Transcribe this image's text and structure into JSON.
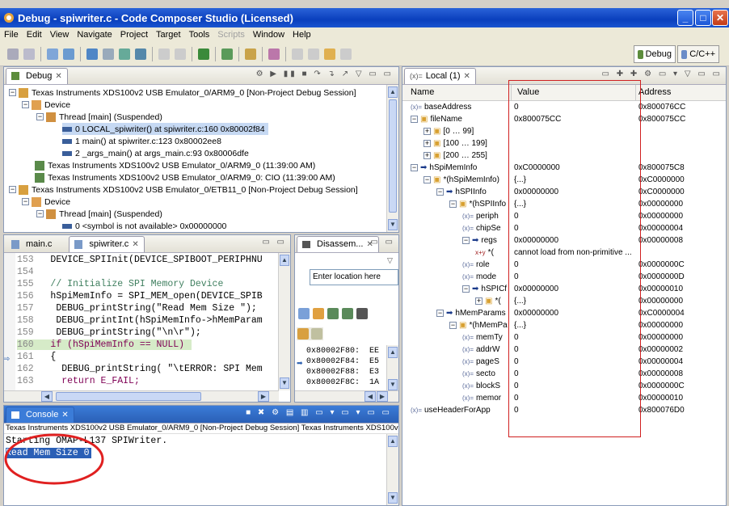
{
  "window": {
    "title": "Debug - spiwriter.c - Code Composer Studio (Licensed)",
    "minimize": "_",
    "maximize": "□",
    "close": "✕"
  },
  "menu": [
    "File",
    "Edit",
    "View",
    "Navigate",
    "Project",
    "Target",
    "Tools",
    "Scripts",
    "Window",
    "Help"
  ],
  "perspectives": {
    "debug": "Debug",
    "cpp": "C/C++"
  },
  "debug_view": {
    "tab": "Debug",
    "items": [
      "Texas Instruments XDS100v2 USB Emulator_0/ARM9_0 [Non-Project Debug Session]",
      "Device",
      "Thread [main] (Suspended)",
      "0 LOCAL_spiwriter() at spiwriter.c:160 0x80002f84",
      "1 main() at spiwriter.c:123 0x80002ee8",
      "2 _args_main() at args_main.c:93 0x80006dfe",
      "Texas Instruments XDS100v2 USB Emulator_0/ARM9_0 (11:39:00 AM)",
      "Texas Instruments XDS100v2 USB Emulator_0/ARM9_0: CIO (11:39:00 AM)",
      "Texas Instruments XDS100v2 USB Emulator_0/ETB11_0 [Non-Project Debug Session]",
      "Device",
      "Thread [main] (Suspended)",
      "0 <symbol is not available> 0x00000000"
    ]
  },
  "editor": {
    "tabs": [
      "main.c",
      "spiwriter.c"
    ],
    "lines": [
      {
        "n": "153",
        "t": "  DEVICE_SPIInit(DEVICE_SPIBOOT_PERIPHNU"
      },
      {
        "n": "154",
        "t": ""
      },
      {
        "n": "155",
        "t": "  // Initialize SPI Memory Device"
      },
      {
        "n": "156",
        "t": "  hSpiMemInfo = SPI_MEM_open(DEVICE_SPIB"
      },
      {
        "n": "157",
        "t": "   DEBUG_printString(\"Read Mem Size \");"
      },
      {
        "n": "158",
        "t": "   DEBUG_printInt(hSpiMemInfo->hMemParam"
      },
      {
        "n": "159",
        "t": "   DEBUG_printString(\"\\n\\r\");"
      },
      {
        "n": "160",
        "t": "  if (hSpiMemInfo == NULL)"
      },
      {
        "n": "161",
        "t": "  {"
      },
      {
        "n": "162",
        "t": "    DEBUG_printString( \"\\tERROR: SPI Mem"
      },
      {
        "n": "163",
        "t": "    return E_FAIL;"
      }
    ]
  },
  "disassembly": {
    "tab": "Disassem...",
    "location_placeholder": "Enter location here",
    "rows": [
      {
        "addr": "0x80002F80:",
        "v": "EE"
      },
      {
        "addr": "0x80002F84:",
        "v": "E5"
      },
      {
        "addr": "0x80002F88:",
        "v": "E3"
      },
      {
        "addr": "0x80002F8C:",
        "v": "1A"
      }
    ]
  },
  "console": {
    "tab": "Console",
    "header": "Texas Instruments XDS100v2 USB Emulator_0/ARM9_0 [Non-Project Debug Session] Texas Instruments XDS100v2",
    "lines": [
      "Starting OMAP-L137 SPIWriter.",
      "Read Mem Size 0"
    ]
  },
  "locals": {
    "tab": "Local (1)",
    "columns": [
      "Name",
      "Value",
      "Address"
    ],
    "rows": [
      {
        "name": "baseAddress",
        "value": "0",
        "addr": "0x800076CC"
      },
      {
        "name": "fileName",
        "value": "0x800075CC",
        "addr": "0x800075CC"
      },
      {
        "name": "[0 … 99]",
        "value": "",
        "addr": ""
      },
      {
        "name": "[100 … 199]",
        "value": "",
        "addr": ""
      },
      {
        "name": "[200 … 255]",
        "value": "",
        "addr": ""
      },
      {
        "name": "hSpiMemInfo",
        "value": "0xC0000000",
        "addr": "0x800075C8"
      },
      {
        "name": "*(hSpiMemInfo)",
        "value": "{...}",
        "addr": "0xC0000000"
      },
      {
        "name": "hSPIInfo",
        "value": "0x00000000",
        "addr": "0xC0000000"
      },
      {
        "name": "*(hSPIInfo",
        "value": "{...}",
        "addr": "0x00000000"
      },
      {
        "name": "periph",
        "value": "0",
        "addr": "0x00000000"
      },
      {
        "name": "chipSe",
        "value": "0",
        "addr": "0x00000004"
      },
      {
        "name": "regs",
        "value": "0x00000000",
        "addr": "0x00000008"
      },
      {
        "name": "*(",
        "value": "cannot load from non-primitive ...",
        "addr": ""
      },
      {
        "name": "role",
        "value": "0",
        "addr": "0x0000000C"
      },
      {
        "name": "mode",
        "value": "0",
        "addr": "0x0000000D"
      },
      {
        "name": "hSPICf",
        "value": "0x00000000",
        "addr": "0x00000010"
      },
      {
        "name": "*(",
        "value": "{...}",
        "addr": "0x00000000"
      },
      {
        "name": "hMemParams",
        "value": "0x00000000",
        "addr": "0xC0000004"
      },
      {
        "name": "*(hMemPa",
        "value": "{...}",
        "addr": "0x00000000"
      },
      {
        "name": "memTy",
        "value": "0",
        "addr": "0x00000000"
      },
      {
        "name": "addrW",
        "value": "0",
        "addr": "0x00000002"
      },
      {
        "name": "pageS",
        "value": "0",
        "addr": "0x00000004"
      },
      {
        "name": "secto",
        "value": "0",
        "addr": "0x00000008"
      },
      {
        "name": "blockS",
        "value": "0",
        "addr": "0x0000000C"
      },
      {
        "name": "memor",
        "value": "0",
        "addr": "0x00000010"
      },
      {
        "name": "useHeaderForApp",
        "value": "0",
        "addr": "0x800076D0"
      }
    ]
  }
}
